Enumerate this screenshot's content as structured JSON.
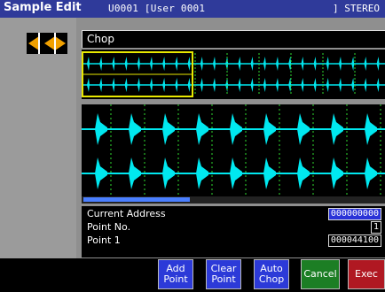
{
  "title_bar": {
    "app_title": "Sample Edit",
    "sample": "U0001 [User 0001",
    "mode": "] STEREO"
  },
  "chop_panel": {
    "tab_label": "Chop"
  },
  "info": {
    "current_address_label": "Current Address",
    "current_address_value": "000000000",
    "point_no_label": "Point No.",
    "point_no_value": "1",
    "point_label": "Point 1",
    "point_value": "000044100"
  },
  "buttons": {
    "add_point": "Add\nPoint",
    "clear_point": "Clear\nPoint",
    "auto_chop": "Auto\nChop",
    "cancel": "Cancel",
    "exec": "Exec"
  },
  "colors": {
    "title_bg": "#2f3a9a",
    "waveform": "#00e8f0",
    "marker": "#2fdc2f",
    "selection": "#e8e800",
    "button_blue": "#2c3ad8",
    "button_green": "#1c7e24",
    "button_red": "#b01822"
  }
}
